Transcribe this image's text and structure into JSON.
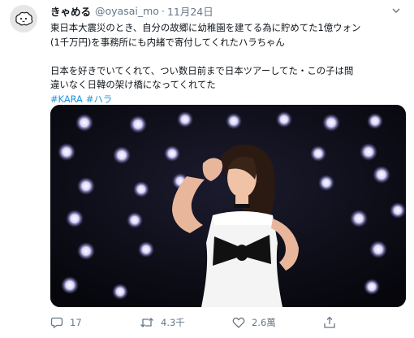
{
  "user": {
    "display_name": "きゃめる",
    "handle": "@oyasai_mo",
    "separator": "·",
    "date": "11月24日"
  },
  "tweet": {
    "lines_para1": [
      "東日本大震災のとき、自分の故郷に幼稚園を建てる為に貯めてた1億ウォン",
      "(1千万円)を事務所にも内緒で寄付してくれたハラちゃん"
    ],
    "lines_para2": [
      "日本を好きでいてくれて、つい数日前まで日本ツアーしてた・この子は間",
      "違いなく日韓の架け橋になってくれてた"
    ],
    "hashtags": [
      "#KARA",
      "#ハラ"
    ]
  },
  "media": {
    "alt": "photo",
    "colors": {
      "background": "#0a0a12",
      "lights": "#c9c4ff",
      "dress": "#f7f7f7",
      "bow": "#111111"
    }
  },
  "actions": {
    "reply_count": "17",
    "retweet_count": "4.3千",
    "like_count": "2.6萬"
  },
  "icons": {
    "avatar": "sheep-avatar-icon",
    "more": "chevron-down-icon",
    "reply": "reply-icon",
    "retweet": "retweet-icon",
    "like": "heart-icon",
    "share": "share-icon"
  },
  "colors": {
    "link": "#1b95e0",
    "secondary": "#657786",
    "text": "#0f1419"
  }
}
